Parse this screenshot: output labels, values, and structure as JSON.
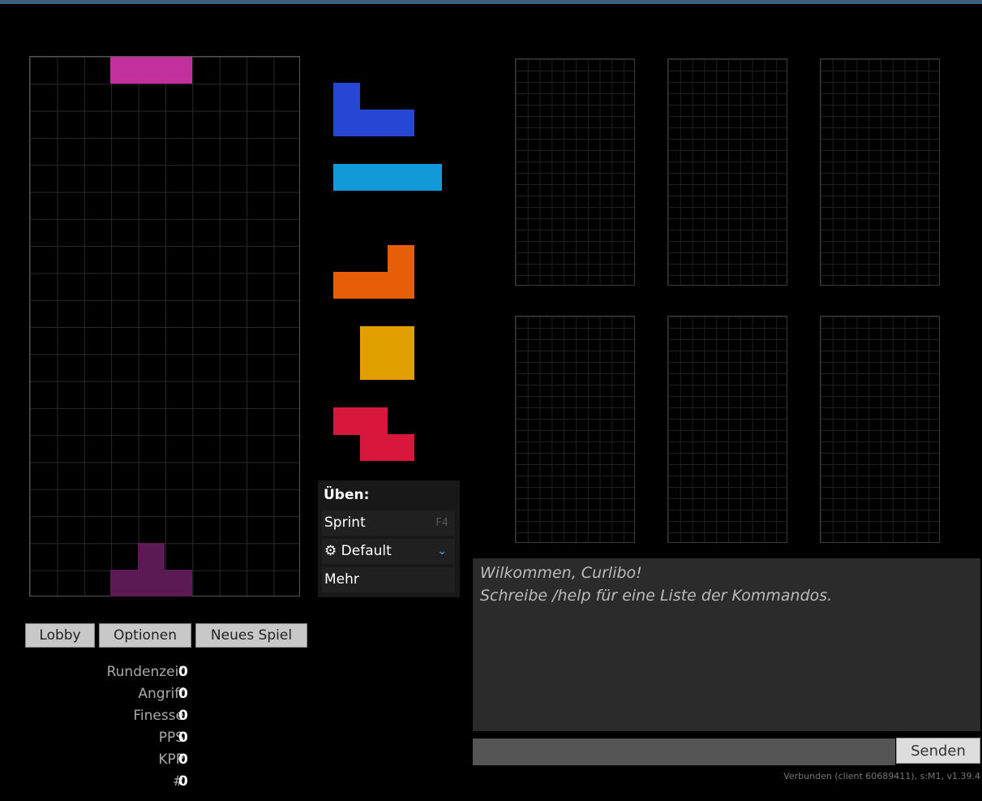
{
  "colors": {
    "active_piece": "#c2309e",
    "ghost_piece": "#5c1a55",
    "J": "#2746d4",
    "I": "#129ad8",
    "L": "#e65e08",
    "O": "#e1a000",
    "Z": "#d8173c"
  },
  "queue_pieces": [
    "J",
    "I",
    "L",
    "O",
    "Z"
  ],
  "practice": {
    "header": "Üben:",
    "sprint_label": "Sprint",
    "sprint_key": "F4",
    "preset_label": "Default",
    "more_label": "Mehr"
  },
  "buttons": {
    "lobby": "Lobby",
    "options": "Optionen",
    "new_game": "Neues Spiel"
  },
  "stats": [
    {
      "label": "Rundenzeit",
      "value": "0"
    },
    {
      "label": "Angriff",
      "value": "0"
    },
    {
      "label": "Finesse",
      "value": "0"
    },
    {
      "label": "PPS",
      "value": "0"
    },
    {
      "label": "KPP",
      "value": "0"
    },
    {
      "label": "#",
      "value": "0"
    }
  ],
  "chat": {
    "line1": "Wilkommen, Curlibo!",
    "line2": "Schreibe /help für eine Liste der Kommandos.",
    "input_value": "",
    "send_label": "Senden"
  },
  "status_text": "Verbunden (client 60689411), s:M1, v1.39.4"
}
